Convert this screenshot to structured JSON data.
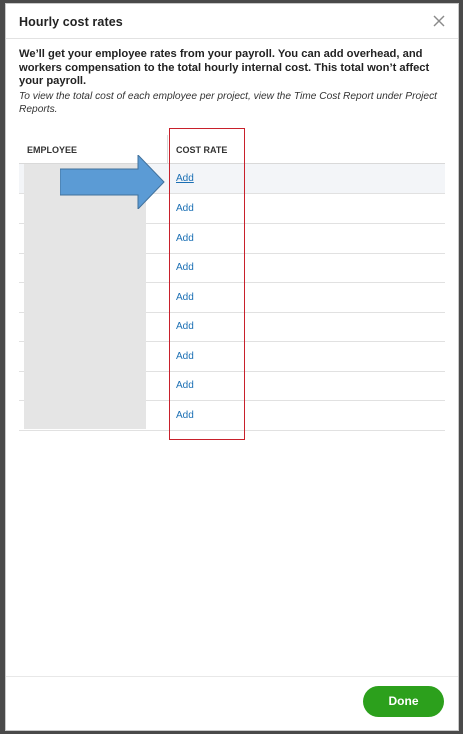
{
  "dialog": {
    "title": "Hourly cost rates",
    "description": "We’ll get your employee rates from your payroll. You can add overhead, and workers compensation to the total hourly internal cost. This total won’t affect your payroll.",
    "note": "To view the total cost of each employee per project, view the Time Cost Report under Project Reports."
  },
  "table": {
    "columns": [
      "EMPLOYEE",
      "COST RATE"
    ],
    "rows": [
      {
        "cost_rate": "Add"
      },
      {
        "cost_rate": "Add"
      },
      {
        "cost_rate": "Add"
      },
      {
        "cost_rate": "Add"
      },
      {
        "cost_rate": "Add"
      },
      {
        "cost_rate": "Add"
      },
      {
        "cost_rate": "Add"
      },
      {
        "cost_rate": "Add"
      },
      {
        "cost_rate": "Add"
      }
    ]
  },
  "footer": {
    "done_label": "Done"
  },
  "icons": {
    "close": "close-icon",
    "arrow": "arrow-annotation"
  },
  "colors": {
    "primary_button": "#2ca01c",
    "link": "#1a6fb4",
    "highlight_border": "#c8202b",
    "arrow_fill": "#5b9bd5"
  }
}
